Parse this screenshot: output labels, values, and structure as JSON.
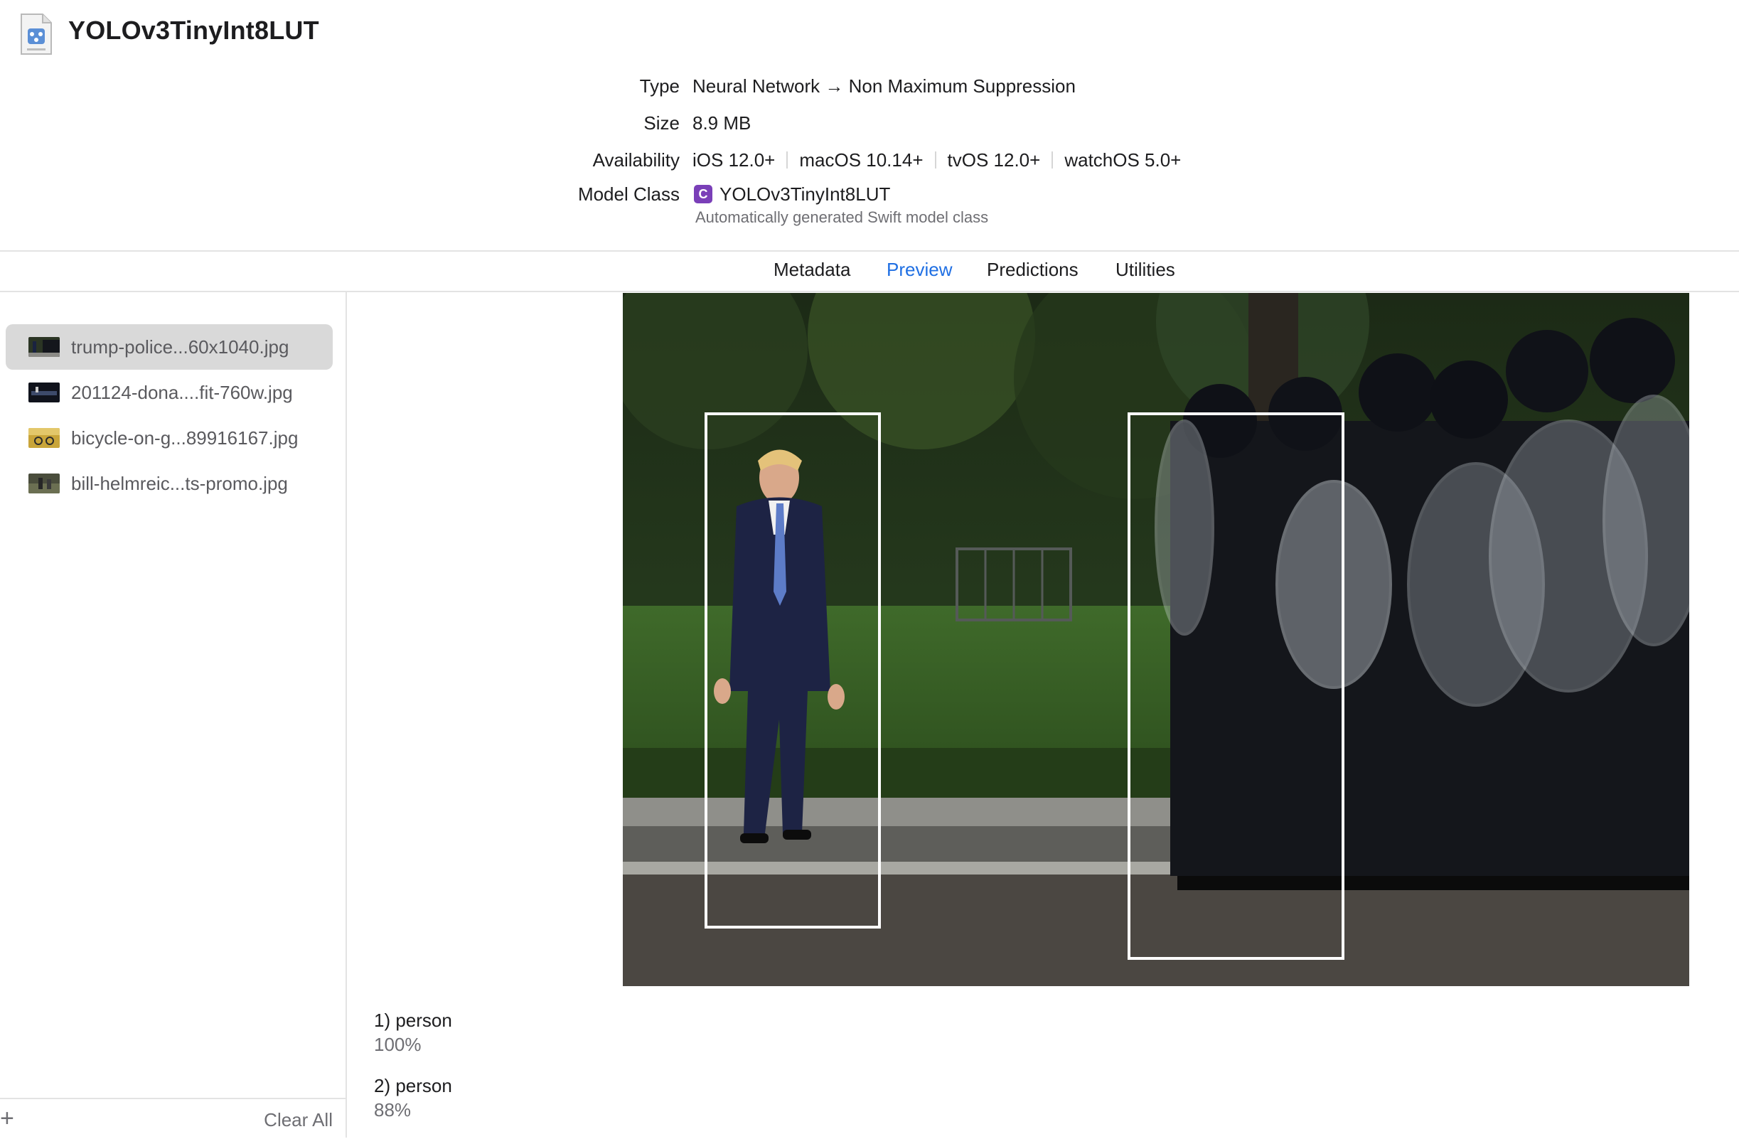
{
  "header": {
    "title": "YOLOv3TinyInt8LUT",
    "info": {
      "type_label": "Type",
      "type_value": "Neural Network → Non Maximum Suppression",
      "size_label": "Size",
      "size_value": "8.9 MB",
      "availability_label": "Availability",
      "availability": [
        "iOS 12.0+",
        "macOS 10.14+",
        "tvOS 12.0+",
        "watchOS 5.0+"
      ],
      "model_class_label": "Model Class",
      "model_class_badge": "C",
      "model_class_value": "YOLOv3TinyInt8LUT",
      "model_class_sub": "Automatically generated Swift model class"
    }
  },
  "tabs": [
    "Metadata",
    "Preview",
    "Predictions",
    "Utilities"
  ],
  "active_tab": "Preview",
  "sidebar": {
    "files": [
      {
        "name": "trump-police...60x1040.jpg",
        "selected": true
      },
      {
        "name": "201124-dona....fit-760w.jpg",
        "selected": false
      },
      {
        "name": "bicycle-on-g...89916167.jpg",
        "selected": false
      },
      {
        "name": "bill-helmreic...ts-promo.jpg",
        "selected": false
      }
    ],
    "add_label": "+",
    "clear_all_label": "Clear All"
  },
  "predictions": [
    {
      "label": "1) person",
      "confidence": "100%"
    },
    {
      "label": "2) person",
      "confidence": "88%"
    }
  ],
  "colors": {
    "accent": "#1f6fe3",
    "class_badge": "#7a3fb8",
    "selection": "#d9d9d9"
  }
}
